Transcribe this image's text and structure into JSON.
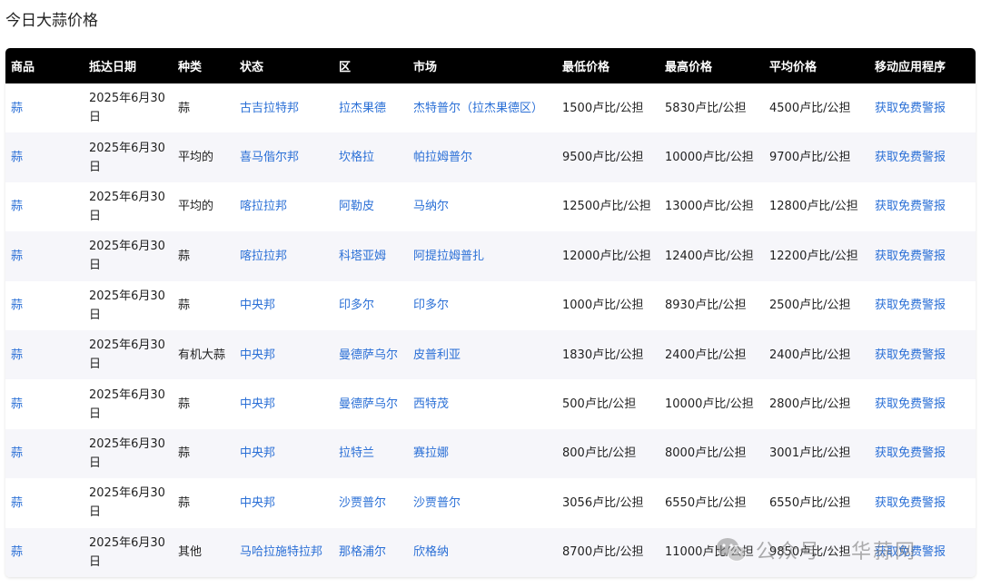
{
  "page": {
    "title": "今日大蒜价格"
  },
  "table": {
    "headers": [
      "商品",
      "抵达日期",
      "种类",
      "状态",
      "区",
      "市场",
      "最低价格",
      "最高价格",
      "平均价格",
      "移动应用程序"
    ],
    "rows": [
      {
        "commodity": "蒜",
        "date": "2025年6月30日",
        "variety": "蒜",
        "state": "古吉拉特邦",
        "district": "拉杰果德",
        "market": "杰特普尔（拉杰果德区）",
        "min": "1500卢比/公担",
        "max": "5830卢比/公担",
        "avg": "4500卢比/公担",
        "app": "获取免费警报"
      },
      {
        "commodity": "蒜",
        "date": "2025年6月30日",
        "variety": "平均的",
        "state": "喜马偕尔邦",
        "district": "坎格拉",
        "market": "帕拉姆普尔",
        "min": "9500卢比/公担",
        "max": "10000卢比/公担",
        "avg": "9700卢比/公担",
        "app": "获取免费警报"
      },
      {
        "commodity": "蒜",
        "date": "2025年6月30日",
        "variety": "平均的",
        "state": "喀拉拉邦",
        "district": "阿勒皮",
        "market": "马纳尔",
        "min": "12500卢比/公担",
        "max": "13000卢比/公担",
        "avg": "12800卢比/公担",
        "app": "获取免费警报"
      },
      {
        "commodity": "蒜",
        "date": "2025年6月30日",
        "variety": "蒜",
        "state": "喀拉拉邦",
        "district": "科塔亚姆",
        "market": "阿提拉姆普扎",
        "min": "12000卢比/公担",
        "max": "12400卢比/公担",
        "avg": "12200卢比/公担",
        "app": "获取免费警报"
      },
      {
        "commodity": "蒜",
        "date": "2025年6月30日",
        "variety": "蒜",
        "state": "中央邦",
        "district": "印多尔",
        "market": "印多尔",
        "min": "1000卢比/公担",
        "max": "8930卢比/公担",
        "avg": "2500卢比/公担",
        "app": "获取免费警报"
      },
      {
        "commodity": "蒜",
        "date": "2025年6月30日",
        "variety": "有机大蒜",
        "state": "中央邦",
        "district": "曼德萨乌尔",
        "market": "皮普利亚",
        "min": "1830卢比/公担",
        "max": "2400卢比/公担",
        "avg": "2400卢比/公担",
        "app": "获取免费警报"
      },
      {
        "commodity": "蒜",
        "date": "2025年6月30日",
        "variety": "蒜",
        "state": "中央邦",
        "district": "曼德萨乌尔",
        "market": "西特茂",
        "min": "500卢比/公担",
        "max": "10000卢比/公担",
        "avg": "2800卢比/公担",
        "app": "获取免费警报"
      },
      {
        "commodity": "蒜",
        "date": "2025年6月30日",
        "variety": "蒜",
        "state": "中央邦",
        "district": "拉特兰",
        "market": "赛拉娜",
        "min": "800卢比/公担",
        "max": "8000卢比/公担",
        "avg": "3001卢比/公担",
        "app": "获取免费警报"
      },
      {
        "commodity": "蒜",
        "date": "2025年6月30日",
        "variety": "蒜",
        "state": "中央邦",
        "district": "沙贾普尔",
        "market": "沙贾普尔",
        "min": "3056卢比/公担",
        "max": "6550卢比/公担",
        "avg": "6550卢比/公担",
        "app": "获取免费警报"
      },
      {
        "commodity": "蒜",
        "date": "2025年6月30日",
        "variety": "其他",
        "state": "马哈拉施特拉邦",
        "district": "那格浦尔",
        "market": "欣格纳",
        "min": "8700卢比/公担",
        "max": "11000卢比/公担",
        "avg": "9850卢比/公担",
        "app": "获取免费警报"
      }
    ]
  },
  "watermark": {
    "brand": "公众号",
    "name": "华蒜网",
    "icon": "wechat-icon"
  },
  "colors": {
    "header_bg": "#000000",
    "link": "#2a6fd6",
    "row_alt": "#f6f6fa"
  }
}
